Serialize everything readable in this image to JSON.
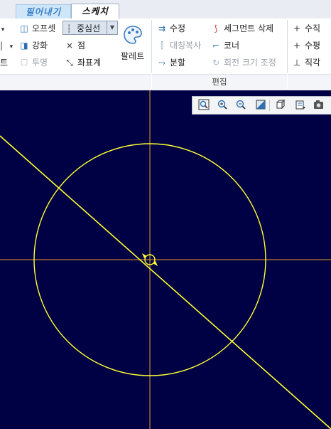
{
  "tabs": [
    {
      "label": "필어내기",
      "active": false
    },
    {
      "label": "스케치",
      "active": true
    }
  ],
  "ribbon": {
    "col1": [
      {
        "label": "",
        "icon": "chevron-down-icon"
      },
      {
        "label": "",
        "icon": "chevron-down-icon"
      },
      {
        "label": "트"
      }
    ],
    "col2": {
      "offset": "오프셋",
      "thicken": "강화",
      "projection": "투영"
    },
    "col3": {
      "centerline": "중심선",
      "point": "점",
      "coordinate": "좌표계"
    },
    "palette": "팔레트",
    "edit": {
      "modify": "수정",
      "mirror": "대칭복사",
      "divide": "분할",
      "delete_segment": "세그먼트 삭제",
      "corner": "코너",
      "rotate_resize": "회전 크기 조정"
    },
    "constrain": {
      "vertical": "수직",
      "horizontal": "수평",
      "perpendicular": "직각"
    },
    "group_label_edit": "편집"
  },
  "view_toolbar": {
    "icons": [
      "zoom-fit-icon",
      "zoom-in-icon",
      "zoom-out-icon",
      "repaint-icon",
      "view-orientation-icon",
      "sketch-view-icon",
      "display-filter-icon",
      "camera-icon"
    ]
  },
  "colors": {
    "canvas_bg": "#000044",
    "geometry": "#ffff33",
    "centerline": "#e0a020"
  },
  "canvas": {
    "circle_radius": 163
  }
}
